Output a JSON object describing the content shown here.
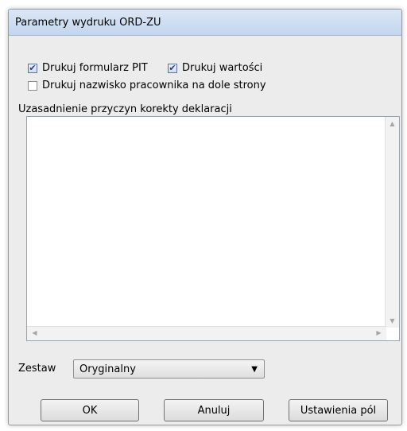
{
  "window": {
    "title": "Parametry wydruku ORD-ZU"
  },
  "options": {
    "print_pit": {
      "label": "Drukuj formularz PIT",
      "checked": true
    },
    "print_values": {
      "label": "Drukuj wartości",
      "checked": true
    },
    "print_employee_name": {
      "label": "Drukuj nazwisko pracownika na dole strony",
      "checked": false
    }
  },
  "justification": {
    "label": "Uzasadnienie przyczyn korekty deklaracji",
    "value": ""
  },
  "set": {
    "label": "Zestaw",
    "selected": "Oryginalny"
  },
  "buttons": {
    "ok": "OK",
    "cancel": "Anuluj",
    "field_settings": "Ustawienia pól"
  },
  "icons": {
    "check": "checkmark-icon",
    "dropdown": "dropdown-arrow-icon"
  }
}
